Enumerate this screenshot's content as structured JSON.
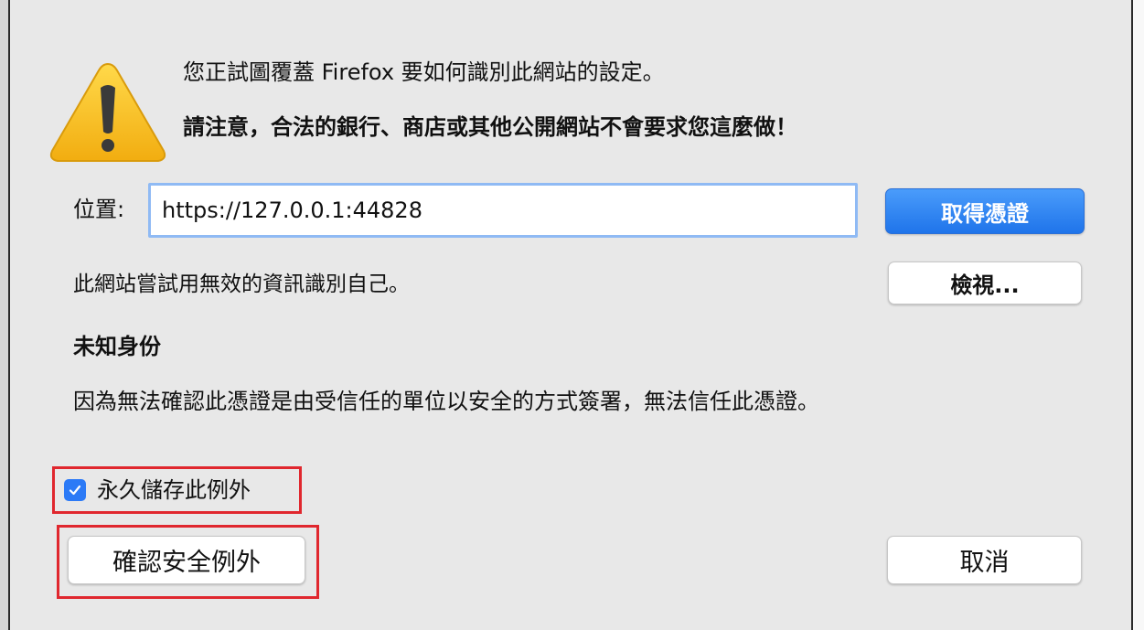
{
  "dialog": {
    "title": "您正試圖覆蓋 Firefox 要如何識別此網站的設定。",
    "warning": "請注意，合法的銀行、商店或其他公開網站不會要求您這麼做！",
    "warning_icon": "warning-triangle-icon"
  },
  "location": {
    "label": "位置:",
    "value": "https://127.0.0.1:44828"
  },
  "buttons": {
    "get_certificate": "取得憑證",
    "view": "檢視...",
    "confirm_exception": "確認安全例外",
    "cancel": "取消"
  },
  "status": {
    "invalid_identity": "此網站嘗試用無效的資訊識別自己。",
    "unknown_identity_heading": "未知身份",
    "untrusted_reason": "因為無法確認此憑證是由受信任的單位以安全的方式簽署，無法信任此憑證。"
  },
  "permanent_store": {
    "label": "永久儲存此例外",
    "checked": true
  },
  "colors": {
    "primary_button": "#1f74ea",
    "checkbox": "#2c7af6",
    "highlight": "#e0272e",
    "warning_icon": "#f7c325"
  }
}
